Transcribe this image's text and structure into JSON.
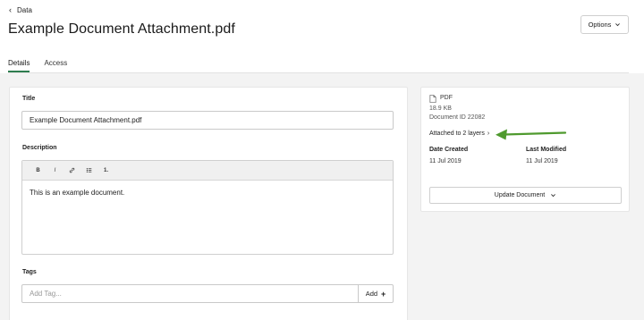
{
  "breadcrumb": {
    "back_label": "Data"
  },
  "page": {
    "title": "Example Document Attachment.pdf"
  },
  "header": {
    "options_label": "Options"
  },
  "tabs": [
    {
      "label": "Details",
      "active": true
    },
    {
      "label": "Access",
      "active": false
    }
  ],
  "form": {
    "title_label": "Title",
    "title_value": "Example Document Attachment.pdf",
    "description_label": "Description",
    "toolbar": {
      "bold": "B",
      "italic": "I",
      "link_icon": "link-icon",
      "bullets_icon": "bulleted-list-icon",
      "numbered": "1."
    },
    "description_value": "This is an example document.",
    "tags_label": "Tags",
    "tags_placeholder": "Add Tag...",
    "add_label": "Add",
    "add_icon": "+"
  },
  "file_info": {
    "type": "PDF",
    "size": "18.9 KB",
    "document_id": "Document ID 22082",
    "attached_label": "Attached to 2 layers",
    "date_created_label": "Date Created",
    "date_created_value": "11 Jul 2019",
    "last_modified_label": "Last Modified",
    "last_modified_value": "11 Jul 2019",
    "update_label": "Update Document"
  },
  "colors": {
    "accent": "#2e7d4f",
    "annotation_arrow": "#4f9a2e",
    "background": "#f3f3f3"
  }
}
